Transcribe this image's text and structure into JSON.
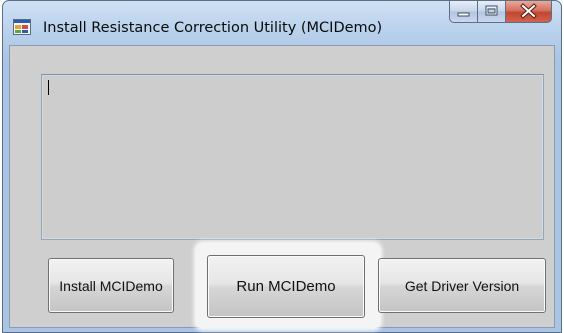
{
  "window": {
    "title": "Install Resistance Correction Utility (MCIDemo)",
    "icon": "app-window-icon",
    "caption_buttons": [
      "minimize-icon",
      "maximize-icon",
      "close-icon"
    ]
  },
  "output_box": {
    "value": ""
  },
  "buttons": {
    "install_label": "Install MCIDemo",
    "run_label": "Run MCIDemo",
    "driver_label": "Get Driver Version"
  },
  "colors": {
    "close_button": "#c14632",
    "titlebar": "#b9d1ec",
    "client_background": "#cfcfcf"
  }
}
